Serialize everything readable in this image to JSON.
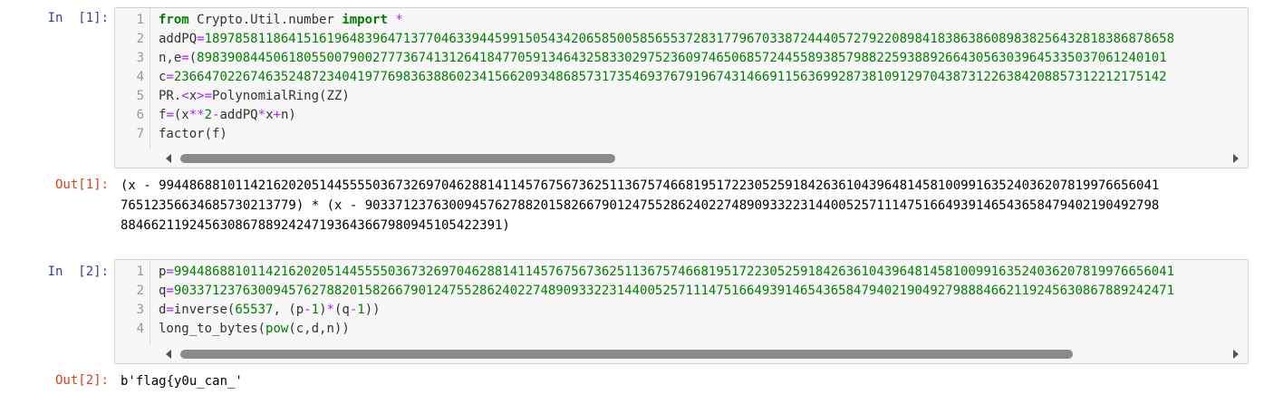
{
  "cells": [
    {
      "prompt": "In  [1]:",
      "lines": [
        {
          "no": "1",
          "tokens": [
            {
              "t": "from",
              "c": "kw"
            },
            {
              "t": " Crypto.Util.number ",
              "c": "plain"
            },
            {
              "t": "import",
              "c": "kw"
            },
            {
              "t": " ",
              "c": "plain"
            },
            {
              "t": "*",
              "c": "op"
            }
          ]
        },
        {
          "no": "2",
          "tokens": [
            {
              "t": "addPQ",
              "c": "plain"
            },
            {
              "t": "=",
              "c": "op"
            },
            {
              "t": "1897858118641516196483964713770463394459915054342065850058565537283177967033872444057279220898418386386089838256432818386878658",
              "c": "num"
            }
          ]
        },
        {
          "no": "3",
          "tokens": [
            {
              "t": "n,e",
              "c": "plain"
            },
            {
              "t": "=",
              "c": "op"
            },
            {
              "t": "(",
              "c": "plain"
            },
            {
              "t": "8983908445061805500790027773674131264184770591346432583302975236097465068572445589385798822593889266430563039645335037061240101",
              "c": "num"
            }
          ]
        },
        {
          "no": "4",
          "tokens": [
            {
              "t": "c",
              "c": "plain"
            },
            {
              "t": "=",
              "c": "op"
            },
            {
              "t": "2366470226746352487234041977698363886023415662093486857317354693767919674314669115636992873810912970438731226384208857312212175142",
              "c": "num"
            }
          ]
        },
        {
          "no": "5",
          "tokens": [
            {
              "t": "PR.",
              "c": "plain"
            },
            {
              "t": "<",
              "c": "op"
            },
            {
              "t": "x",
              "c": "plain"
            },
            {
              "t": ">=",
              "c": "op"
            },
            {
              "t": "PolynomialRing(ZZ)",
              "c": "plain"
            }
          ]
        },
        {
          "no": "6",
          "tokens": [
            {
              "t": "f",
              "c": "plain"
            },
            {
              "t": "=",
              "c": "op"
            },
            {
              "t": "(x",
              "c": "plain"
            },
            {
              "t": "**",
              "c": "op"
            },
            {
              "t": "2",
              "c": "num"
            },
            {
              "t": "-",
              "c": "op"
            },
            {
              "t": "addPQ",
              "c": "plain"
            },
            {
              "t": "*",
              "c": "op"
            },
            {
              "t": "x",
              "c": "plain"
            },
            {
              "t": "+",
              "c": "op"
            },
            {
              "t": "n)",
              "c": "plain"
            }
          ]
        },
        {
          "no": "7",
          "tokens": [
            {
              "t": "factor(f)",
              "c": "plain"
            }
          ]
        }
      ],
      "out_prompt": "Out[1]:",
      "output_lines": [
        "(x - 99448688101142162020514455550367326970462881411457675673625113675746681951722305259184263610439648145810099163524036207819976656041",
        "76512356634685730213779) * (x - 9033712376300945762788201582667901247552862402274890933223144005257111475166493914654365847940219049279​8",
        "8846621192456308678892424719364366798094510542239​1)"
      ]
    },
    {
      "prompt": "In  [2]:",
      "lines": [
        {
          "no": "1",
          "tokens": [
            {
              "t": "p",
              "c": "plain"
            },
            {
              "t": "=",
              "c": "op"
            },
            {
              "t": "99448688101142162020514455550367326970462881411457675673625113675746681951722305259184263610439648145810099163524036207819976656041",
              "c": "num"
            }
          ]
        },
        {
          "no": "2",
          "tokens": [
            {
              "t": "q",
              "c": "plain"
            },
            {
              "t": "=",
              "c": "op"
            },
            {
              "t": "90337123763009457627882015826679012475528624022748909332231440052571114751664939146543658479402190492798884662119245630867889242471",
              "c": "num"
            }
          ]
        },
        {
          "no": "3",
          "tokens": [
            {
              "t": "d",
              "c": "plain"
            },
            {
              "t": "=",
              "c": "op"
            },
            {
              "t": "inverse",
              "c": "plain"
            },
            {
              "t": "(",
              "c": "plain"
            },
            {
              "t": "65537",
              "c": "num"
            },
            {
              "t": ", (p",
              "c": "plain"
            },
            {
              "t": "-",
              "c": "op"
            },
            {
              "t": "1",
              "c": "num"
            },
            {
              "t": ")",
              "c": "plain"
            },
            {
              "t": "*",
              "c": "op"
            },
            {
              "t": "(q",
              "c": "plain"
            },
            {
              "t": "-",
              "c": "op"
            },
            {
              "t": "1",
              "c": "num"
            },
            {
              "t": "))",
              "c": "plain"
            }
          ]
        },
        {
          "no": "4",
          "tokens": [
            {
              "t": "long_to_bytes(",
              "c": "plain"
            },
            {
              "t": "pow",
              "c": "bi"
            },
            {
              "t": "(c,d,n))",
              "c": "plain"
            }
          ]
        }
      ],
      "out_prompt": "Out[2]:",
      "output_lines": [
        "b'flag{y0u_can_'"
      ]
    }
  ]
}
